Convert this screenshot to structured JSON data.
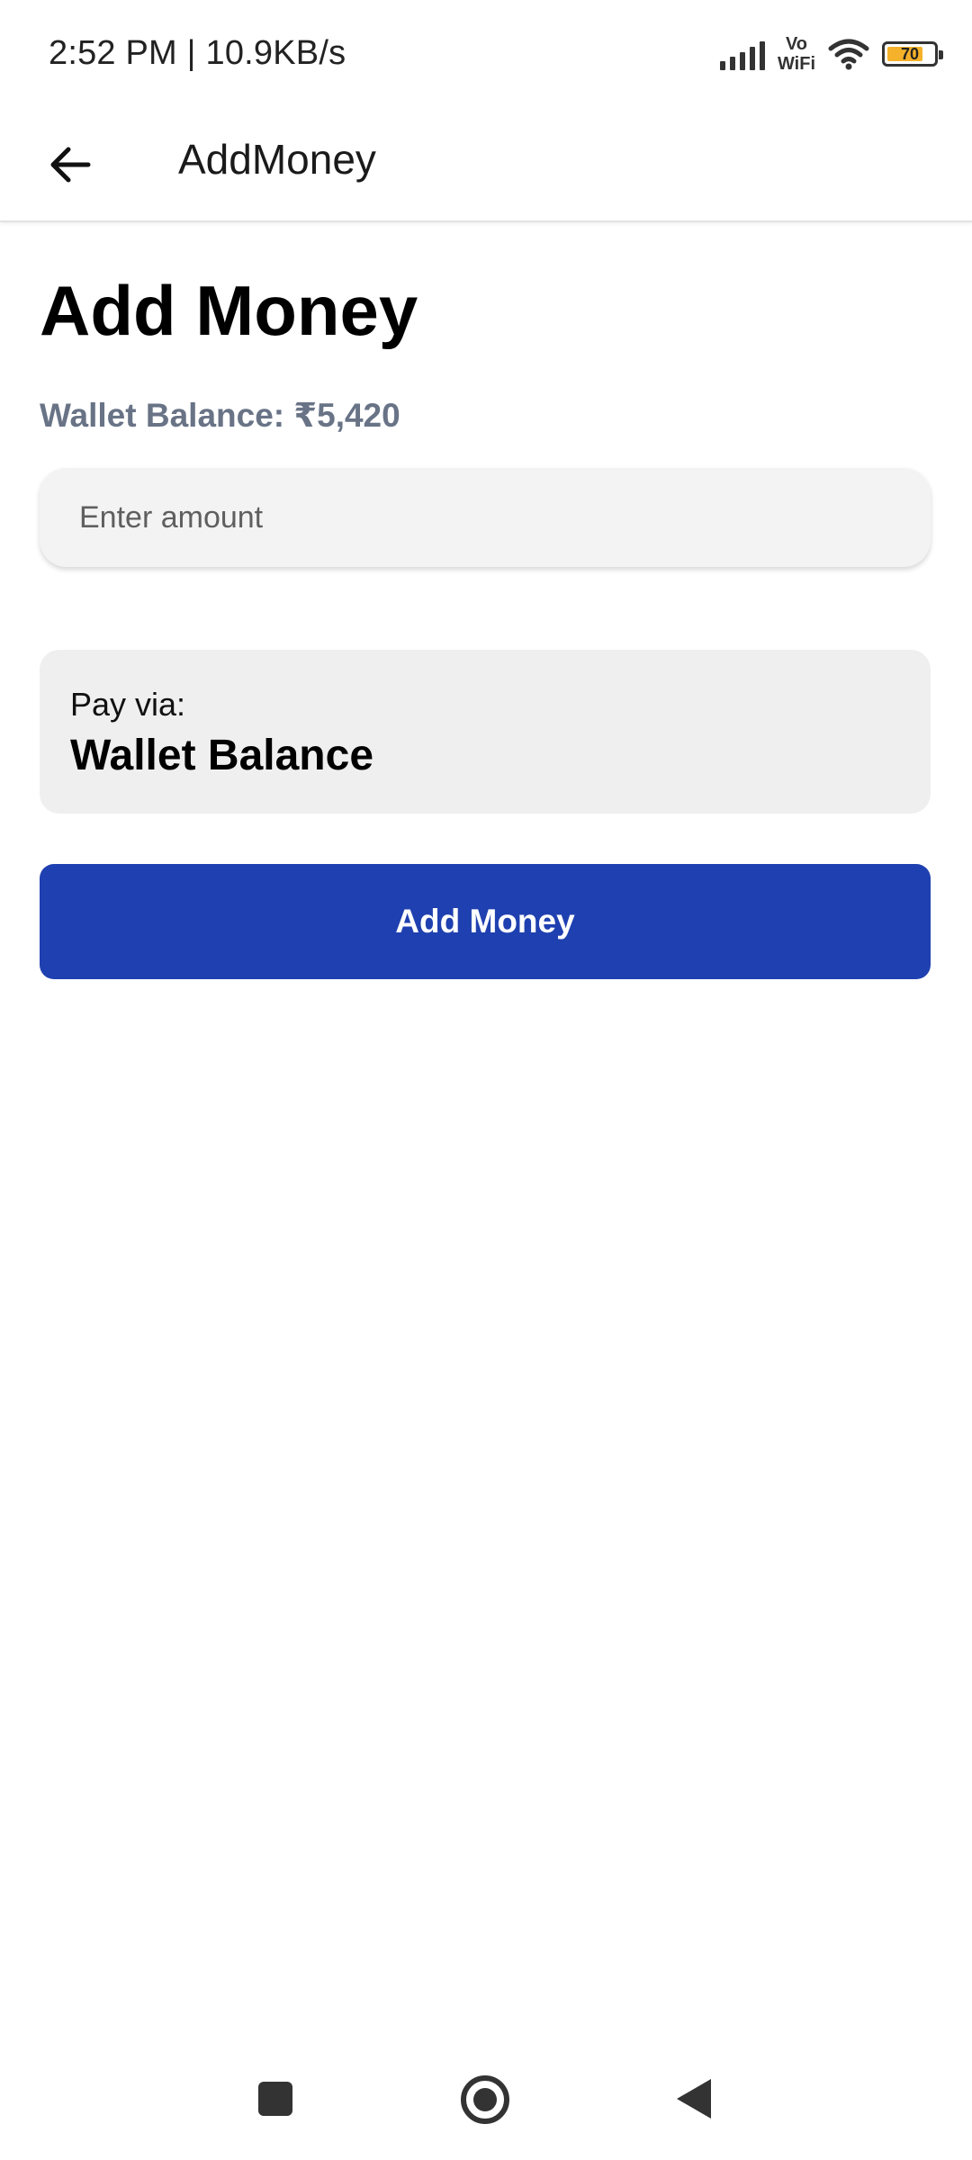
{
  "status_bar": {
    "time": "2:52 PM | 10.9KB/s",
    "vowifi_line1": "Vo",
    "vowifi_line2": "WiFi",
    "battery_level": "70"
  },
  "app_bar": {
    "title": "AddMoney",
    "back_icon": "arrow-left-icon"
  },
  "main": {
    "heading": "Add Money",
    "wallet_balance": "Wallet Balance: ₹5,420",
    "amount_input": {
      "value": "",
      "placeholder": "Enter amount"
    },
    "pay_via_label": "Pay via:",
    "pay_via_method": "Wallet Balance",
    "submit_label": "Add Money"
  },
  "colors": {
    "primary_button": "#1f40b0",
    "balance_text": "#687386",
    "battery_fill": "#f5b129"
  },
  "nav_bar": {
    "recents_icon": "square-icon",
    "home_icon": "circle-icon",
    "back_icon": "triangle-back-icon"
  }
}
